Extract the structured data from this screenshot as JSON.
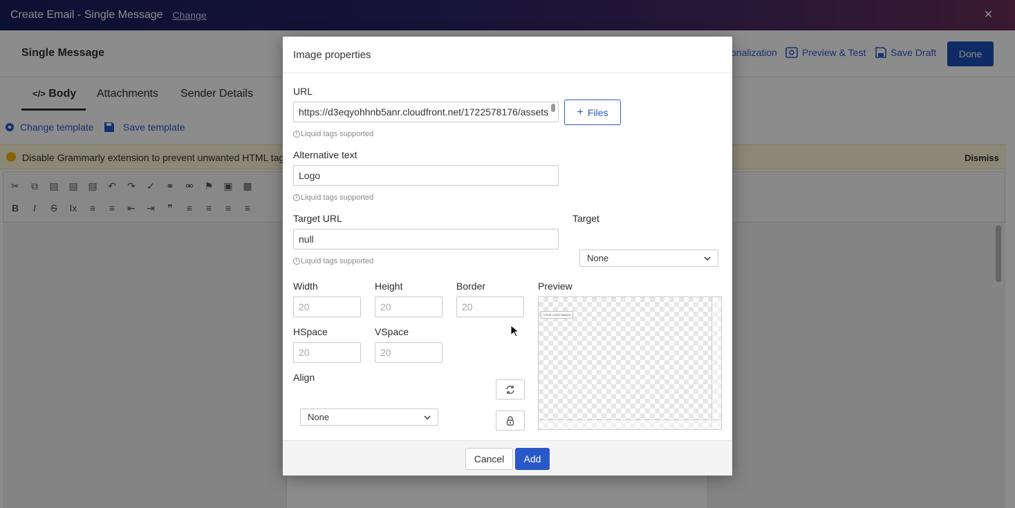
{
  "app": {
    "window_title": "Create Email - Single Message",
    "change_link": "Change",
    "close_glyph": "✕"
  },
  "header": {
    "page_title": "Single Message",
    "personalization_label": "onalization",
    "preview_test_label": "Preview & Test",
    "save_draft_label": "Save Draft",
    "done_label": "Done"
  },
  "tabs": [
    {
      "label": "Body",
      "icon": "code-icon",
      "active": true
    },
    {
      "label": "Attachments",
      "active": false
    },
    {
      "label": "Sender Details",
      "active": false
    }
  ],
  "template_actions": {
    "change_template": "Change template",
    "save_template": "Save template"
  },
  "banner": {
    "message": "Disable Grammarly extension to prevent unwanted HTML tag",
    "dismiss": "Dismiss"
  },
  "dialog": {
    "title": "Image properties",
    "url": {
      "label": "URL",
      "value": "https://d3eqyohhnb5anr.cloudfront.net/1722578176/assets",
      "hint": "Liquid tags supported"
    },
    "files_button": "Files",
    "alt_text": {
      "label": "Alternative text",
      "value": "Logo",
      "hint": "Liquid tags supported"
    },
    "target_url": {
      "label": "Target URL",
      "value": "null",
      "hint": "Liquid tags supported"
    },
    "target": {
      "label": "Target",
      "selected": "None"
    },
    "width": {
      "label": "Width",
      "placeholder": "20"
    },
    "height": {
      "label": "Height",
      "placeholder": "20"
    },
    "border": {
      "label": "Border",
      "placeholder": "20"
    },
    "hspace": {
      "label": "HSpace",
      "placeholder": "20"
    },
    "vspace": {
      "label": "VSpace",
      "placeholder": "20"
    },
    "align": {
      "label": "Align",
      "selected": "None"
    },
    "preview": {
      "label": "Preview",
      "image_text": "YOUR LOGO IMAGE"
    },
    "cancel_label": "Cancel",
    "add_label": "Add"
  },
  "colors": {
    "primary": "#2a58c8",
    "done_button": "#1d4fb8",
    "banner_bg": "#fff7d9",
    "banner_dot": "#f0b400"
  }
}
